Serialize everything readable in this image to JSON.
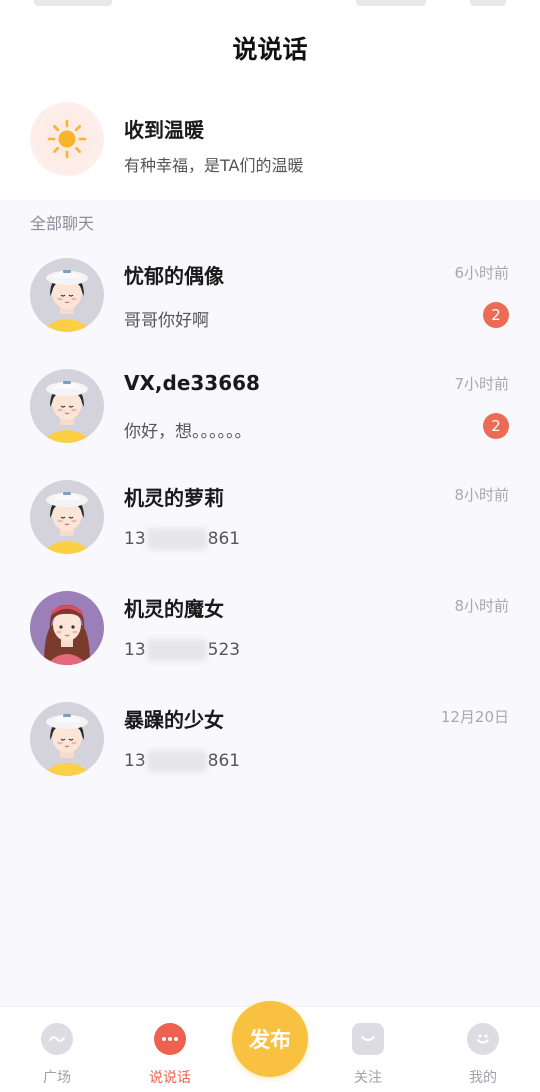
{
  "header": {
    "title": "说说话"
  },
  "warm_card": {
    "icon": "sun-icon",
    "title": "收到温暖",
    "subtitle": "有种幸福，是TA们的温暖"
  },
  "section": {
    "label": "全部聊天"
  },
  "chats": [
    {
      "name": "忧郁的偶像",
      "time": "6小时前",
      "preview": "哥哥你好啊",
      "unread": "2",
      "avatar": "girl-hat-avatar"
    },
    {
      "name": "VX,de33668",
      "time": "7小时前",
      "preview": "你好，想。。。。。。",
      "unread": "2",
      "avatar": "girl-hat-avatar"
    },
    {
      "name": "机灵的萝莉",
      "time": "8小时前",
      "preview_prefix": "13",
      "preview_suffix": "861",
      "avatar": "girl-hat-avatar"
    },
    {
      "name": "机灵的魔女",
      "time": "8小时前",
      "preview_prefix": "13",
      "preview_suffix": "523",
      "avatar": "girl-headband-avatar"
    },
    {
      "name": "暴躁的少女",
      "time": "12月20日",
      "preview_prefix": "13",
      "preview_suffix": "861",
      "avatar": "girl-hat-avatar"
    }
  ],
  "nav": {
    "items": [
      {
        "label": "广场",
        "icon": "plaza-icon"
      },
      {
        "label": "说说话",
        "icon": "chat-bubble-icon",
        "active": true
      },
      {
        "label": "发布",
        "icon": "publish-button"
      },
      {
        "label": "关注",
        "icon": "follow-icon"
      },
      {
        "label": "我的",
        "icon": "profile-icon"
      }
    ]
  },
  "colors": {
    "accent": "#ee6150",
    "publish": "#f8c140",
    "badge": "#ec6b55",
    "background": "#f9f8fc"
  }
}
